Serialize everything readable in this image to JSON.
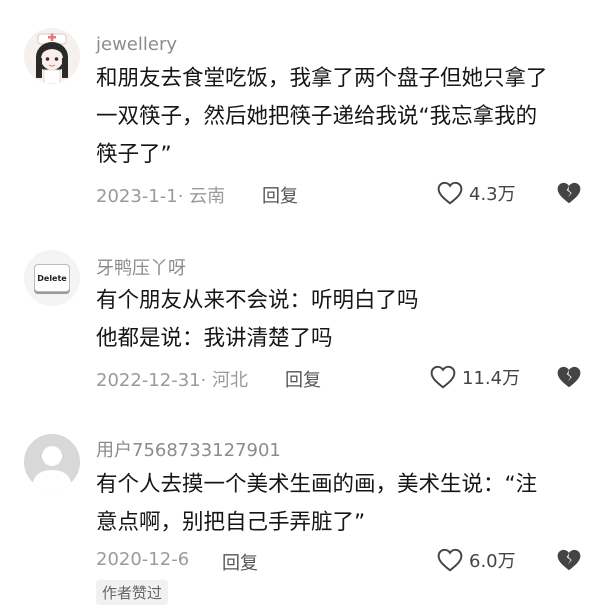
{
  "comments": [
    {
      "username": "jewellery",
      "content_lines": [
        "和朋友去食堂吃饭，我拿了两个盘子但她只拿了",
        "一双筷子，然后她把筷子递给我说“我忘拿我的",
        "筷子了”"
      ],
      "date": "2023-1-1",
      "location": "· 云南",
      "reply_label": "回复",
      "like_count": "4.3万",
      "avatar_icon": "anime-girl-avatar-icon"
    },
    {
      "username": "牙鸭压丫呀",
      "content_lines": [
        "有个朋友从来不会说：听明白了吗",
        "他都是说：我讲清楚了吗"
      ],
      "date": "2022-12-31",
      "location": "· 河北",
      "reply_label": "回复",
      "like_count": "11.4万",
      "avatar_icon": "delete-key-avatar-icon",
      "avatar_text": "Delete"
    },
    {
      "username": "用户7568733127901",
      "content_lines": [
        "有个人去摸一个美术生画的画，美术生说：“注",
        "意点啊，别把自己手弄脏了”"
      ],
      "date": "2020-12-6",
      "location": "",
      "reply_label": "回复",
      "like_count": "6.0万",
      "avatar_icon": "default-user-avatar-icon",
      "badge": "作者赞过"
    }
  ]
}
